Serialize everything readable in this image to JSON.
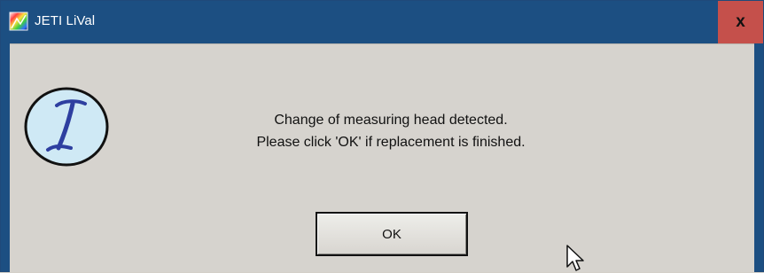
{
  "window": {
    "title": "JETI LiVal",
    "close_glyph": "x"
  },
  "dialog": {
    "icon": "info-i-icon",
    "message_line1": "Change of measuring head detected.",
    "message_line2": "Please click 'OK' if replacement is finished.",
    "ok_label": "OK"
  },
  "colors": {
    "titlebar": "#1c4f82",
    "close_button": "#c5504b",
    "client_background": "#d6d3ce"
  }
}
